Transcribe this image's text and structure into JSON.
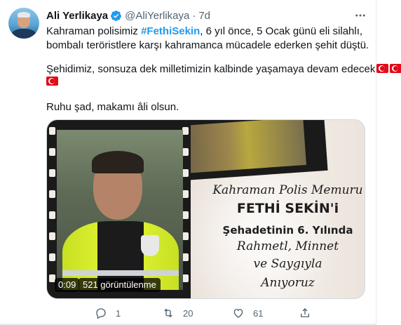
{
  "colors": {
    "link": "#1d9bf0",
    "text": "#0f1419",
    "muted": "#536471",
    "verified": "#1d9bf0"
  },
  "tweet": {
    "author_name": "Ali Yerlikaya",
    "handle": "@AliYerlikaya",
    "separator": "·",
    "time": "7d",
    "line1_pre": "Kahraman polisimiz ",
    "hashtag": "#FethiSekin",
    "line1_post": ", 6 yıl önce, 5 Ocak günü eli silahlı,",
    "line2": "bombalı teröristlere karşı kahramanca mücadele ederken şehit düştü.",
    "line3": "Şehidimiz, sonsuza dek milletimizin kalbinde yaşamaya devam edecek",
    "line4": "Ruhu şad, makamı âli olsun."
  },
  "media": {
    "caption_line1": "Kahraman Polis Memuru",
    "caption_line2": "FETHİ SEKİN'i",
    "caption_line3": "Şehadetinin 6. Yılında",
    "caption_line4": "Rahmetl, Minnet",
    "caption_line5": "ve Saygıyla",
    "caption_line6": "Anıyoruz",
    "video_time": "0:09",
    "video_views": "521 görüntülenme"
  },
  "actions": {
    "replies": "1",
    "retweets": "20",
    "likes": "61"
  },
  "icons": [
    "verified-badge-icon",
    "more-options-icon",
    "reply-icon",
    "retweet-icon",
    "like-icon",
    "share-icon",
    "turkish-flag-icon"
  ]
}
